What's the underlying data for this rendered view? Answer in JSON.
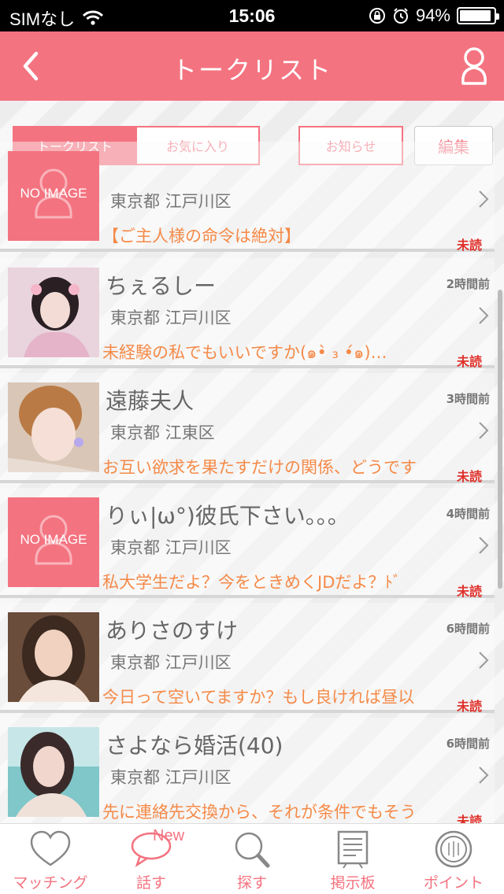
{
  "status_bar": {
    "carrier": "SIMなし",
    "time": "15:06",
    "battery": "94%",
    "battery_level": 0.94
  },
  "header": {
    "title": "トークリスト",
    "back_icon": "chevron-left-icon",
    "profile_icon": "person-icon"
  },
  "tabs": {
    "talk_list": "トークリスト",
    "favorites": "お気に入り",
    "news": "お知らせ",
    "edit": "編集"
  },
  "conversations": [
    {
      "name": "",
      "time_ago": "",
      "area": "東京都 江戸川区",
      "message": "【ご主人様の命令は絶対】",
      "unread": "未読",
      "avatar": "NO IMAGE"
    },
    {
      "name": "ちぇるしー",
      "time_ago": "2時間前",
      "area": "東京都 江戸川区",
      "message": "未経験の私でもいいですか(๑•̀ ₃ •́๑)…",
      "unread": "未読",
      "avatar": ""
    },
    {
      "name": "遠藤夫人",
      "time_ago": "3時間前",
      "area": "東京都 江東区",
      "message": "お互い欲求を果たすだけの関係、どうです",
      "unread": "未読",
      "avatar": ""
    },
    {
      "name": "りぃ|ω°)彼氏下さい。。。",
      "time_ago": "4時間前",
      "area": "東京都 江戸川区",
      "message": "私大学生だよ？今をときめくJDだよ？ﾄﾞ",
      "unread": "未読",
      "avatar": "NO IMAGE"
    },
    {
      "name": "ありさのすけ",
      "time_ago": "6時間前",
      "area": "東京都 江戸川区",
      "message": "今日って空いてますか？もし良ければ昼以",
      "unread": "未読",
      "avatar": ""
    },
    {
      "name": "さよなら婚活(40)",
      "time_ago": "6時間前",
      "area": "東京都 江戸川区",
      "message": "先に連絡先交換から、それが条件でもそう",
      "unread": "未読",
      "avatar": ""
    }
  ],
  "bottom_nav": {
    "matching": "マッチング",
    "talk": "話す",
    "talk_badge": "New",
    "search": "探す",
    "board": "掲示板",
    "points": "ポイント"
  },
  "colors": {
    "accent": "#f47380",
    "message": "#f58a48",
    "unread": "#e0302a"
  }
}
